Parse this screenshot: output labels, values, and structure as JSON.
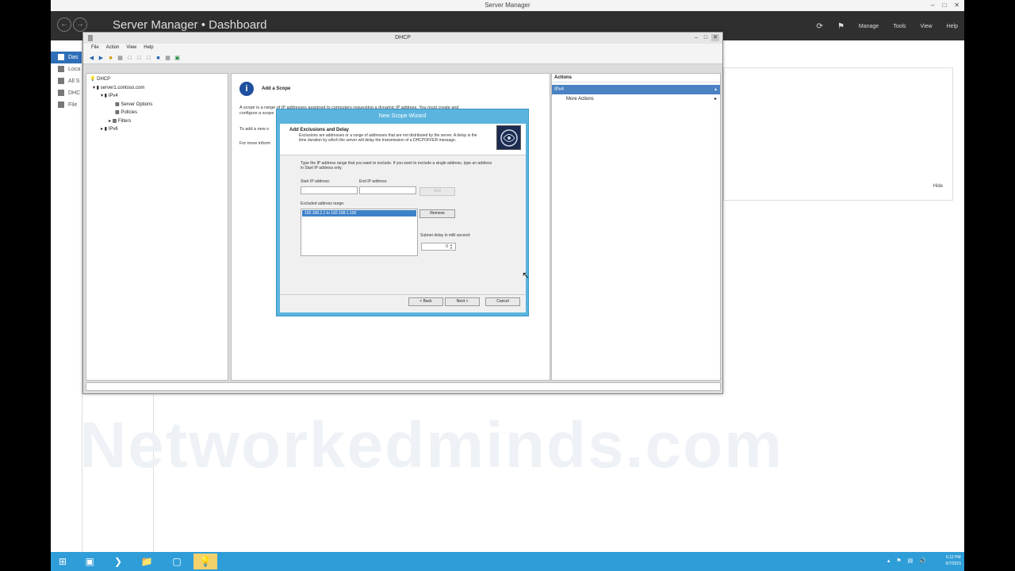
{
  "server_manager": {
    "window_title": "Server Manager",
    "breadcrumb": "Server Manager • Dashboard",
    "menus": [
      "Manage",
      "Tools",
      "View",
      "Help"
    ],
    "left_nav": [
      "Das",
      "Loca",
      "All S",
      "DHC",
      "File"
    ],
    "hide_label": "Hide"
  },
  "watermark": "Networkedminds.com",
  "dhcp": {
    "title": "DHCP",
    "menu": [
      "File",
      "Action",
      "View",
      "Help"
    ],
    "tree": {
      "root": "DHCP",
      "server": "server1.contoso.com",
      "ipv4": "IPv4",
      "server_options": "Server Options",
      "policies": "Policies",
      "filters": "Filters",
      "ipv6": "IPv6"
    },
    "center": {
      "heading": "Add a Scope",
      "para1_line1": "A scope is a range of IP addresses assigned to computers requesting a dynamic IP address. You must create and",
      "para1_line2": "configure a scope",
      "para2": "To add a new s",
      "para3": "For more inform"
    },
    "actions": {
      "header": "Actions",
      "group": "IPv4",
      "more": "More Actions"
    }
  },
  "wizard": {
    "title": "New Scope Wizard",
    "step_title": "Add Exclusions and Delay",
    "step_desc": "Exclusions are addresses or a range of addresses that are not distributed by the server. A delay is the time duration by which the server will delay the transmission of a DHCPOFFER message.",
    "instruction": "Type the IP address range that you want to exclude. If you want to exclude a single address, type an address in Start IP address only.",
    "start_ip_label": "Start IP address:",
    "start_ip_value": ".",
    "end_ip_label": "End IP address:",
    "end_ip_value": "",
    "add_button": "Add",
    "excluded_label": "Excluded address range:",
    "excluded_item": "192.168.1.1 to 192.168.1.100",
    "remove_button": "Remove",
    "delay_label": "Subnet delay in milli second:",
    "delay_value": "0",
    "back_button": "< Back",
    "next_button": "Next >",
    "cancel_button": "Cancel"
  },
  "taskbar": {
    "time": "6:12 PM",
    "date": "6/7/2015"
  }
}
